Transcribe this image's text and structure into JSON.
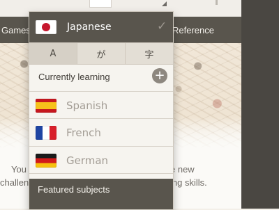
{
  "background": {
    "nav": {
      "games": "Games",
      "reference": "Reference"
    },
    "text_left": [
      "You",
      "challen"
    ],
    "text_right": [
      "e new",
      "ing skills."
    ]
  },
  "dropdown": {
    "selected_language": {
      "label": "Japanese",
      "flag": "japan-flag-icon"
    },
    "check_icon": "✓",
    "script_tabs": [
      {
        "label": "A"
      },
      {
        "label": "が"
      },
      {
        "label": "字"
      }
    ],
    "section_currently_learning": "Currently learning",
    "add_icon": "+",
    "languages": [
      {
        "label": "Spanish",
        "flag": "spain-flag-icon"
      },
      {
        "label": "French",
        "flag": "france-flag-icon"
      },
      {
        "label": "German",
        "flag": "germany-flag-icon"
      }
    ],
    "section_featured": "Featured subjects"
  },
  "colors": {
    "header_bg": "#59554d",
    "panel_bg": "#f6f4ef",
    "tab_bg": "#e3ded5",
    "muted_text": "#a39d95"
  }
}
